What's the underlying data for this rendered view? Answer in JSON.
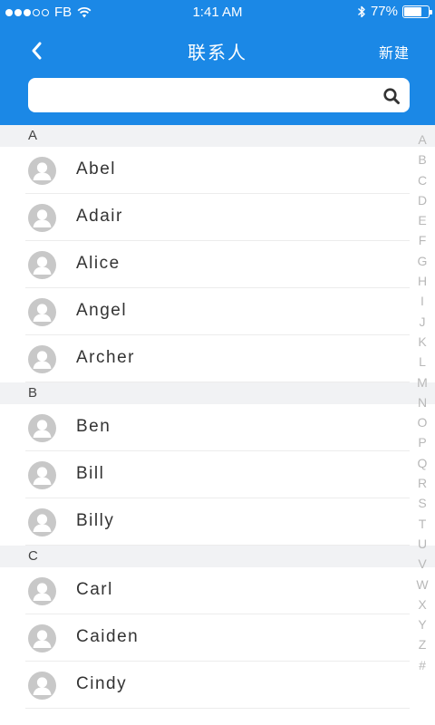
{
  "status_bar": {
    "carrier": "FB",
    "time": "1:41 AM",
    "battery_percent": "77%",
    "battery_level": 0.77
  },
  "nav": {
    "title": "联系人",
    "action_label": "新建",
    "back_icon": "chevron-left-icon"
  },
  "search": {
    "value": "",
    "placeholder": ""
  },
  "sections": [
    {
      "letter": "A",
      "contacts": [
        "Abel",
        "Adair",
        "Alice",
        "Angel",
        "Archer"
      ]
    },
    {
      "letter": "B",
      "contacts": [
        "Ben",
        "Bill",
        "Billy"
      ]
    },
    {
      "letter": "C",
      "contacts": [
        "Carl",
        "Caiden",
        "Cindy"
      ]
    }
  ],
  "index_letters": [
    "A",
    "B",
    "C",
    "D",
    "E",
    "F",
    "G",
    "H",
    "I",
    "J",
    "K",
    "L",
    "M",
    "N",
    "O",
    "P",
    "Q",
    "R",
    "S",
    "T",
    "U",
    "V",
    "W",
    "X",
    "Y",
    "Z",
    "#"
  ],
  "colors": {
    "primary": "#1b88e6",
    "section_bg": "#f1f2f4",
    "avatar": "#c8c8c8",
    "index_text": "#b8b8b8"
  }
}
